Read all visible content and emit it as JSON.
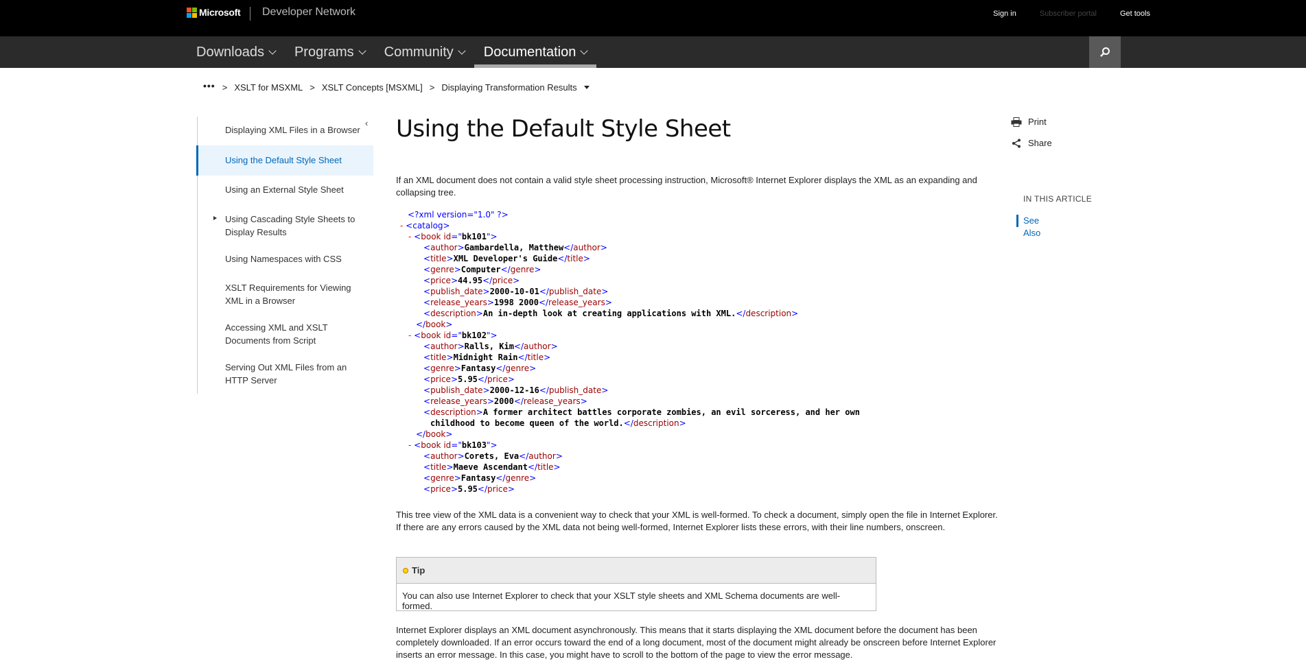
{
  "header": {
    "brand": "Microsoft",
    "product": "Developer Network",
    "links": {
      "sign_in": "Sign in",
      "subscriber_portal": "Subscriber portal",
      "get_tools": "Get tools"
    }
  },
  "nav": {
    "items": [
      {
        "label": "Downloads"
      },
      {
        "label": "Programs"
      },
      {
        "label": "Community"
      },
      {
        "label": "Documentation"
      }
    ],
    "active": "Documentation",
    "search_icon": "search-icon"
  },
  "breadcrumb": {
    "more": "•••",
    "separator": ">",
    "items": [
      "XSLT for MSXML",
      "XSLT Concepts [MSXML]",
      "Displaying Transformation Results"
    ]
  },
  "sidebar": {
    "items": [
      {
        "label": "Displaying XML Files in a Browser"
      },
      {
        "label": "Using the Default Style Sheet"
      },
      {
        "label": "Using an External Style Sheet"
      },
      {
        "label": "Using Cascading Style Sheets to Display Results"
      },
      {
        "label": "Using Namespaces with CSS"
      },
      {
        "label": "XSLT Requirements for Viewing XML in a Browser"
      },
      {
        "label": "Accessing XML and XSLT Documents from Script"
      },
      {
        "label": "Serving Out XML Files from an HTTP Server"
      }
    ],
    "active_index": 1,
    "collapse_glyph": "‹"
  },
  "article": {
    "title": "Using the Default Style Sheet",
    "intro": "If an XML document does not contain a valid style sheet processing instruction, Microsoft® Internet Explorer displays the XML as an expanding and collapsing tree.",
    "para2": "This tree view of the XML data is a convenient way to check that your XML is well-formed. To check a document, simply open the file in Internet Explorer. If there are any errors caused by the XML data not being well-formed, Internet Explorer lists these errors, with their line numbers, onscreen.",
    "tip": {
      "heading": "Tip",
      "body": "You can also use Internet Explorer to check that your XSLT style sheets and XML Schema documents are well-formed."
    },
    "para3": "Internet Explorer displays an XML document asynchronously. This means that it starts displaying the XML document before the document has been completely downloaded. If an error occurs toward the end of a long document, most of the document might already be onscreen before Internet Explorer inserts an error message. In this case, you might have to scroll to the bottom of the page to view the error message.",
    "xml_tree": {
      "declaration": "<?xml version=\"1.0\" ?>",
      "minus": "-",
      "catalog_open": "<catalog>",
      "book_close": "</book>",
      "books": [
        {
          "open_tag": "<book id=\"",
          "id": "bk101",
          "open_tag_end": "\">",
          "fields": [
            {
              "name": "author",
              "value": "Gambardella, Matthew"
            },
            {
              "name": "title",
              "value": "XML Developer's Guide"
            },
            {
              "name": "genre",
              "value": "Computer"
            },
            {
              "name": "price",
              "value": "44.95"
            },
            {
              "name": "publish_date",
              "value": "2000-10-01"
            },
            {
              "name": "release_years",
              "value": "1998 2000"
            },
            {
              "name": "description",
              "value": "An in-depth look at creating applications with XML."
            }
          ]
        },
        {
          "open_tag": "<book id=\"",
          "id": "bk102",
          "open_tag_end": "\">",
          "fields": [
            {
              "name": "author",
              "value": "Ralls, Kim"
            },
            {
              "name": "title",
              "value": "Midnight Rain"
            },
            {
              "name": "genre",
              "value": "Fantasy"
            },
            {
              "name": "price",
              "value": "5.95"
            },
            {
              "name": "publish_date",
              "value": "2000-12-16"
            },
            {
              "name": "release_years",
              "value": "2000"
            },
            {
              "name": "description",
              "value_line1": "A former architect battles corporate zombies, an evil sorceress, and her own",
              "value_line2": "childhood to become queen of the world."
            }
          ]
        },
        {
          "open_tag": "<book id=\"",
          "id": "bk103",
          "open_tag_end": "\">",
          "fields": [
            {
              "name": "author",
              "value": "Corets, Eva"
            },
            {
              "name": "title",
              "value": "Maeve Ascendant"
            },
            {
              "name": "genre",
              "value": "Fantasy"
            },
            {
              "name": "price",
              "value": "5.95"
            }
          ]
        }
      ]
    }
  },
  "right_rail": {
    "print": "Print",
    "share": "Share",
    "in_this_article": "IN THIS ARTICLE",
    "links": [
      "See Also"
    ]
  },
  "colors": {
    "topbar": "#000000",
    "navbar": "#2b2b2b",
    "accent": "#0067b8",
    "xml_markup": "#0000ff",
    "xml_tagname": "#990000",
    "xml_minus": "#ff0000"
  }
}
